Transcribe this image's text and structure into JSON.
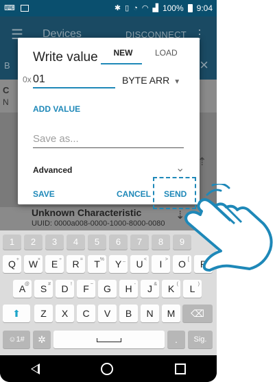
{
  "status_bar": {
    "battery": "100%",
    "time": "9:04",
    "icons": [
      "keyboard-icon",
      "image-icon",
      "bluetooth-icon",
      "vibrate-icon",
      "alarm-icon",
      "wifi-icon",
      "signal-icon",
      "battery-icon"
    ]
  },
  "toolbar": {
    "title": "Devices",
    "disconnect_label": "DISCONNECT",
    "menu_icon": "☰",
    "more_icon": "⋮"
  },
  "tabbar": {
    "left_text": "B",
    "close_icon": "×"
  },
  "background_rows": {
    "row1_c": "C",
    "row1_n": "N",
    "unknown_title": "Unknown Characteristic",
    "unknown_uuid": "UUID: 0000a008-0000-1000-8000-0080"
  },
  "dialog": {
    "title": "Write value",
    "tabs": [
      {
        "label": "NEW",
        "active": true
      },
      {
        "label": "LOAD",
        "active": false
      }
    ],
    "prefix": "0x",
    "value": "01",
    "type": "BYTE ARR",
    "add_value_label": "ADD VALUE",
    "save_as_placeholder": "Save as...",
    "advanced_label": "Advanced",
    "buttons": {
      "save": "SAVE",
      "cancel": "CANCEL",
      "send": "SEND"
    }
  },
  "keyboard": {
    "numbers": [
      "1",
      "2",
      "3",
      "4",
      "5",
      "6",
      "7",
      "8",
      "9"
    ],
    "row1": [
      {
        "k": "Q",
        "s": "+"
      },
      {
        "k": "W",
        "s": "×"
      },
      {
        "k": "E",
        "s": "÷"
      },
      {
        "k": "R",
        "s": "="
      },
      {
        "k": "T",
        "s": "%"
      },
      {
        "k": "Y",
        "s": "_"
      },
      {
        "k": "U",
        "s": "<"
      },
      {
        "k": "I",
        "s": ">"
      },
      {
        "k": "O",
        "s": "["
      },
      {
        "k": "P",
        "s": "]"
      }
    ],
    "row2": [
      {
        "k": "A",
        "s": "@"
      },
      {
        "k": "S",
        "s": "#"
      },
      {
        "k": "D",
        "s": "!"
      },
      {
        "k": "F",
        "s": "~"
      },
      {
        "k": "G",
        "s": ""
      },
      {
        "k": "H",
        "s": "-"
      },
      {
        "k": "J",
        "s": "&"
      },
      {
        "k": "K",
        "s": "("
      },
      {
        "k": "L",
        "s": ")"
      }
    ],
    "row3": [
      {
        "k": "Z",
        "s": ""
      },
      {
        "k": "X",
        "s": ""
      },
      {
        "k": "C",
        "s": ""
      },
      {
        "k": "V",
        "s": ""
      },
      {
        "k": "B",
        "s": ""
      },
      {
        "k": "N",
        "s": ""
      },
      {
        "k": "M",
        "s": ""
      }
    ],
    "symbols_key": "☺1#",
    "settings_key": "✲",
    "period_key": ".",
    "go_key": "Sig.",
    "backspace_key": "⌫",
    "shift_key": "⬆"
  },
  "colors": {
    "accent": "#1e88b8",
    "toolbar_dim": "#1a4a63",
    "overlay": "#7a7a7a"
  }
}
